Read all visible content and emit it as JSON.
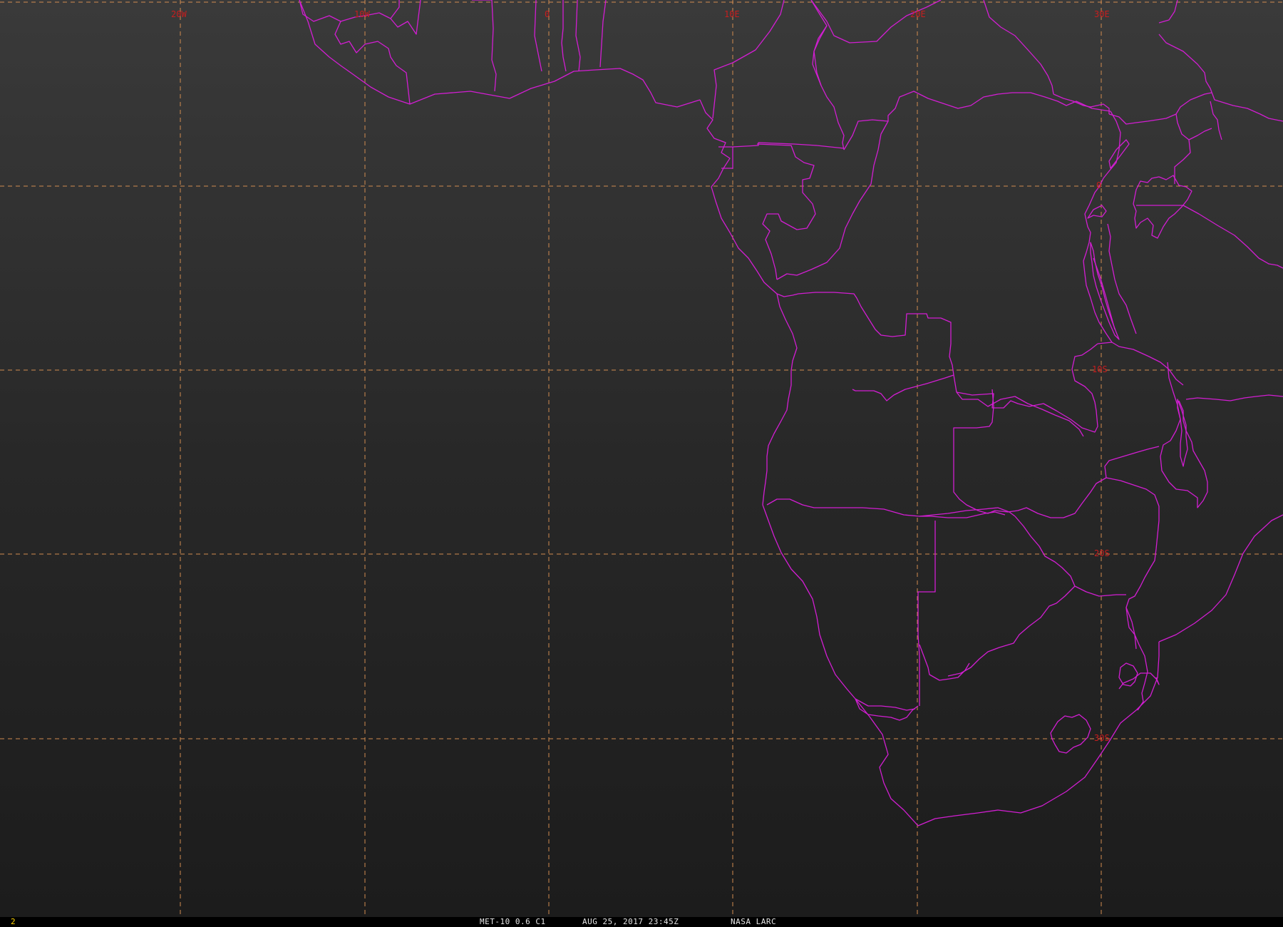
{
  "footer": {
    "frame_number": "2",
    "satellite": "MET-10 0.6 C1",
    "datetime": "AUG 25, 2017 23:45Z",
    "source": "NASA LARC"
  },
  "graticule": {
    "lon_labels": [
      "20W",
      "10W",
      "0",
      "10E",
      "20E",
      "30E"
    ],
    "lat_labels": [
      "0",
      "10S",
      "20S",
      "30S"
    ]
  },
  "colors": {
    "background": "#262626",
    "borders": "#d21ed2",
    "grid": "#d28c50",
    "labels": "#c81e1e",
    "frame_number": "#ffd400"
  }
}
